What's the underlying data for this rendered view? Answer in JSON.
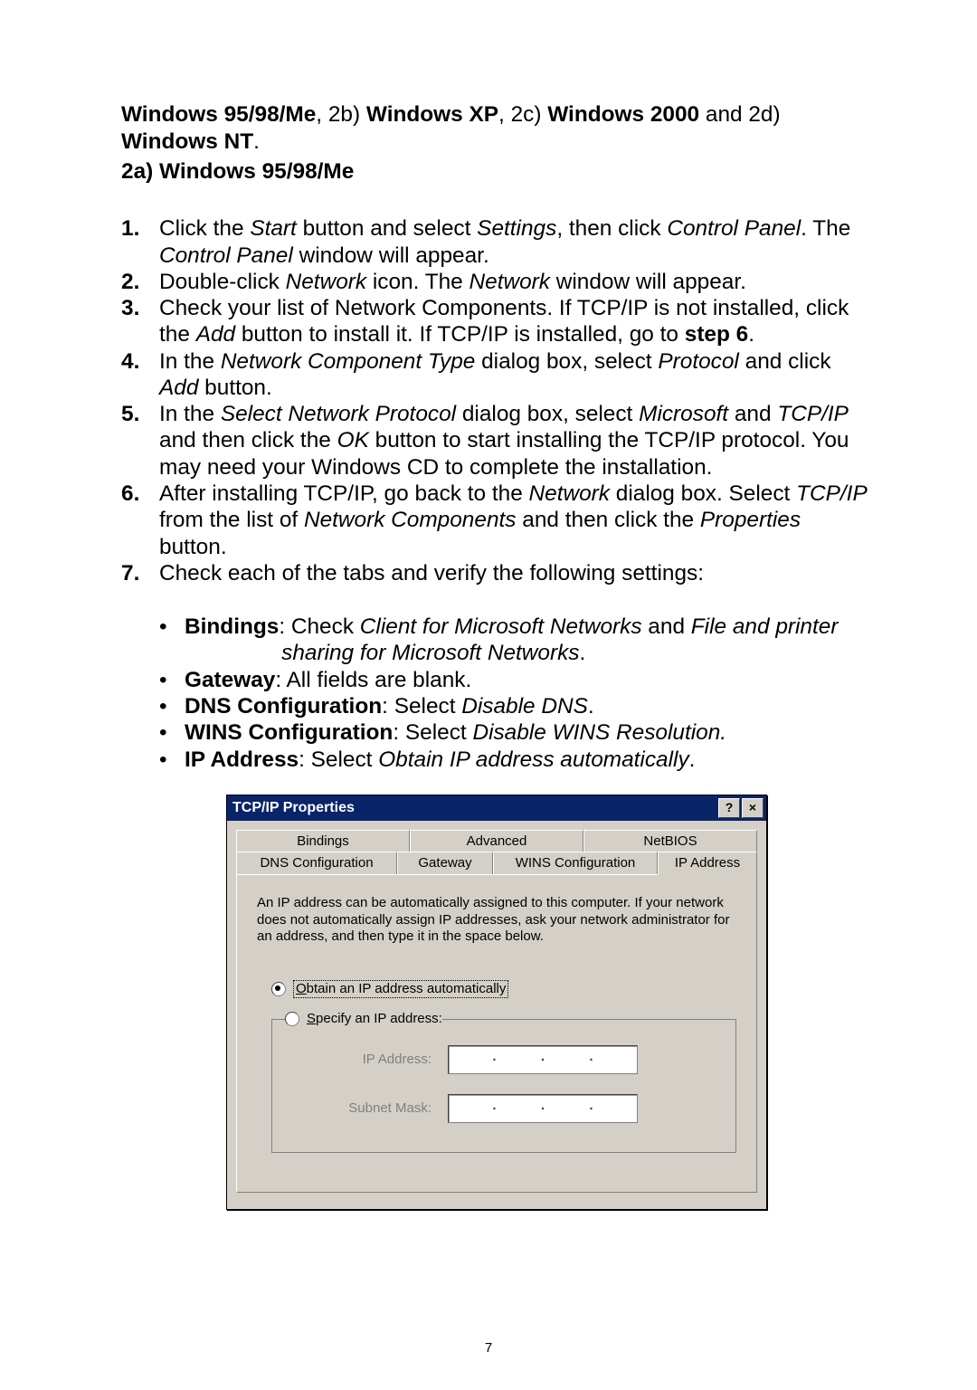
{
  "intro_parts": {
    "p1": "Windows 95/98/Me",
    "p2": ", 2b) ",
    "p3": "Windows XP",
    "p4": ", 2c) ",
    "p5": "Windows 2000",
    "p6": " and 2d) ",
    "p7": "Windows NT",
    "p8": "."
  },
  "section_heading": "2a) Windows 95/98/Me",
  "steps": [
    {
      "num": "1.",
      "html": "Click the <span class=\"italic\">Start</span> button and select <span class=\"italic\">Settings</span>, then click <span class=\"italic\">Control Panel</span>. The <span class=\"italic\">Control Panel</span> window will appear."
    },
    {
      "num": "2.",
      "html": "Double-click <span class=\"italic\">Network</span> icon. The <span class=\"italic\">Network</span> window will appear."
    },
    {
      "num": "3.",
      "html": "Check your list of Network Components. If TCP/IP is not installed, click the <span class=\"italic\">Add</span> button to install it. If TCP/IP is installed, go to <b>step 6</b>."
    },
    {
      "num": "4.",
      "html": "In the <span class=\"italic\">Network Component Type</span> dialog box, select <span class=\"italic\">Protocol</span> and click <span class=\"italic\">Add</span> button."
    },
    {
      "num": "5.",
      "html": "In the <span class=\"italic\">Select Network Protocol</span> dialog box, select <span class=\"italic\">Microsoft</span> and <span class=\"italic\">TCP/IP</span> and then click the <span class=\"italic\">OK</span> button to start installing the TCP/IP protocol. You may need your Windows CD to complete the installation."
    },
    {
      "num": "6.",
      "html": "After installing TCP/IP, go back to the <span class=\"italic\">Network</span> dialog box. Select <span class=\"italic\">TCP/IP</span> from the list of <span class=\"italic\">Network Components</span> and then click the <span class=\"italic\">Properties</span> button."
    },
    {
      "num": "7.",
      "html": "Check each of the tabs and verify the following settings:"
    }
  ],
  "bullets": [
    "<b>Bindings</b>: Check <span class=\"italic\">Client for Microsoft Networks</span> and <span class=\"italic\">File and printer</span><br><span style=\"visibility:hidden\">Bindings: </span><span class=\"italic\">sharing for Microsoft Networks</span>.",
    "<b>Gateway</b>: All fields are blank.",
    "<b>DNS Configuration</b>: Select <span class=\"italic\">Disable DNS</span>.",
    "<b>WINS Configuration</b>: Select <span class=\"italic\">Disable WINS Resolution.</span>",
    "<b>IP Address</b>: Select <span class=\"italic\">Obtain IP address automatically</span>."
  ],
  "dialog": {
    "title": "TCP/IP Properties",
    "help_btn": "?",
    "close_btn": "×",
    "tabs_top": [
      "Bindings",
      "Advanced",
      "NetBIOS"
    ],
    "tabs_bottom": [
      "DNS Configuration",
      "Gateway",
      "WINS Configuration",
      "IP Address"
    ],
    "active_tab": "IP Address",
    "description": "An IP address can be automatically assigned to this computer. If your network does not automatically assign IP addresses, ask your network administrator for an address, and then type it in the space below.",
    "radio_obtain": "Obtain an IP address automatically",
    "radio_specify": "Specify an IP address:",
    "field_ip": "IP Address:",
    "field_subnet": "Subnet Mask:"
  },
  "page_number": "7"
}
